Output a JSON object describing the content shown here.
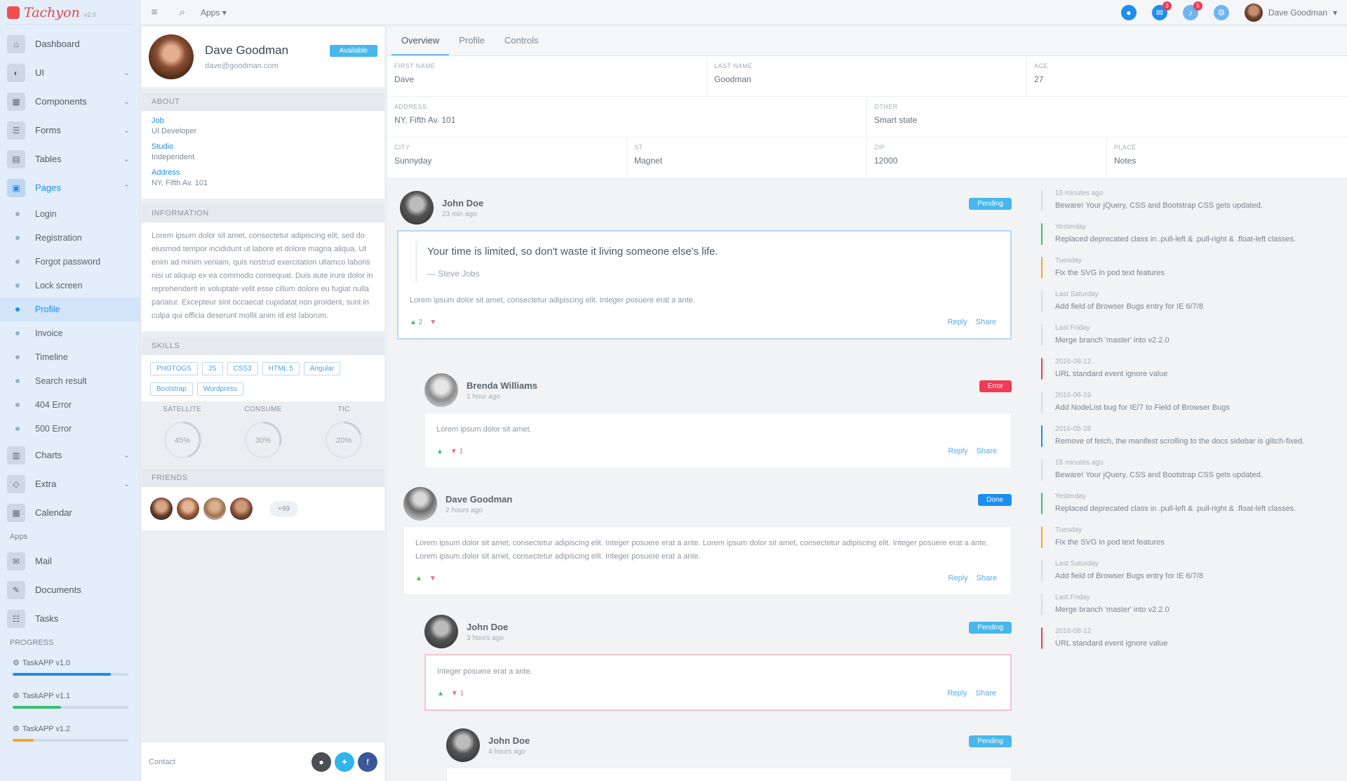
{
  "brand": {
    "name": "Tachyon",
    "sub": "v2.0"
  },
  "sidebar": {
    "items": [
      {
        "label": "Dashboard",
        "icon": "home-icon"
      },
      {
        "label": "UI",
        "icon": "palette-icon",
        "chevron": true
      },
      {
        "label": "Components",
        "icon": "puzzle-icon",
        "chevron": true
      },
      {
        "label": "Forms",
        "icon": "form-icon",
        "chevron": true
      },
      {
        "label": "Tables",
        "icon": "table-icon",
        "chevron": true
      },
      {
        "label": "Pages",
        "icon": "pages-icon",
        "chevron": true,
        "active": true
      }
    ],
    "subitems": [
      {
        "label": "Login"
      },
      {
        "label": "Registration"
      },
      {
        "label": "Forgot password"
      },
      {
        "label": "Lock screen"
      },
      {
        "label": "Profile",
        "active": true
      },
      {
        "label": "Invoice"
      },
      {
        "label": "Timeline"
      },
      {
        "label": "Search result"
      },
      {
        "label": "404 Error"
      },
      {
        "label": "500 Error"
      }
    ],
    "items2": [
      {
        "label": "Charts",
        "icon": "chart-icon",
        "chevron": true
      },
      {
        "label": "Extra",
        "icon": "extra-icon",
        "chevron": true
      },
      {
        "label": "Calendar",
        "icon": "calendar-icon"
      }
    ],
    "apps_head": "Apps",
    "apps": [
      {
        "label": "Mail",
        "icon": "mail-icon"
      },
      {
        "label": "Documents",
        "icon": "pencil-icon"
      },
      {
        "label": "Tasks",
        "icon": "tasks-icon"
      }
    ],
    "progress_head": "PROGRESS",
    "progress": [
      {
        "label": "TaskAPP v1.0",
        "value": 0.85,
        "color": "#1c8ef0"
      },
      {
        "label": "TaskAPP v1.1",
        "value": 0.42,
        "color": "#3cbf6e"
      },
      {
        "label": "TaskAPP v1.2",
        "value": 0.18,
        "color": "#f5a623"
      }
    ]
  },
  "topbar": {
    "language": "Apps",
    "user_name": "Dave Goodman",
    "icons": [
      {
        "name": "circle-icon",
        "color": "#1c8ef0",
        "badge": ""
      },
      {
        "name": "chat-icon",
        "color": "#1c8ef0",
        "badge": "3"
      },
      {
        "name": "bell-icon",
        "color": "#6fb4f2",
        "badge": "5"
      },
      {
        "name": "gear-icon",
        "color": "#6fb4f2",
        "badge": ""
      }
    ]
  },
  "profile": {
    "name": "Dave Goodman",
    "email": "dave@goodman.com",
    "status": "Available",
    "about_head": "ABOUT",
    "about": [
      {
        "key": "Job",
        "value": "UI Developer"
      },
      {
        "key": "Studio",
        "value": "Independent"
      },
      {
        "key": "Address",
        "value": "NY, Fifth Av. 101"
      }
    ],
    "info_head": "INFORMATION",
    "info_text": "Lorem ipsum dolor sit amet, consectetur adipiscing elit, sed do eiusmod tempor incididunt ut labore et dolore magna aliqua. Ut enim ad minim veniam, quis nostrud exercitation ullamco laboris nisi ut aliquip ex ea commodo consequat. Duis aute irure dolor in reprehenderit in voluptate velit esse cillum dolore eu fugiat nulla pariatur. Excepteur sint occaecat cupidatat non proident, sunt in culpa qui officia deserunt mollit anim id est laborum.",
    "skills_head": "SKILLS",
    "skills": [
      "PHOTOGS",
      "JS",
      "CSS3",
      "HTML 5",
      "Angular",
      "Bootstrap",
      "Wordpress"
    ],
    "gauges": [
      {
        "label": "SATELLITE",
        "value": 45,
        "text": "45%"
      },
      {
        "label": "CONSUME",
        "value": 30,
        "text": "30%"
      },
      {
        "label": "TIC",
        "value": 20,
        "text": "20%"
      }
    ],
    "friends_head": "FRIENDS",
    "friends_more": "+99",
    "contact_label": "Contact"
  },
  "main": {
    "tabs": [
      {
        "label": "Overview",
        "active": true
      },
      {
        "label": "Profile"
      },
      {
        "label": "Controls"
      }
    ],
    "fields": [
      [
        {
          "label": "FIRST NAME",
          "value": "Dave"
        },
        {
          "label": "LAST NAME",
          "value": "Goodman"
        },
        {
          "label": "AGE",
          "value": "27"
        }
      ],
      [
        {
          "label": "ADDRESS",
          "value": "NY, Fifth Av. 101"
        },
        {
          "label": "OTHER",
          "value": "Smart state"
        }
      ],
      [
        {
          "label": "CITY",
          "value": "Sunnyday"
        },
        {
          "label": "ST",
          "value": "Magnet"
        },
        {
          "label": "ZIP",
          "value": "12000"
        },
        {
          "label": "PLACE",
          "value": "Notes"
        }
      ]
    ]
  },
  "feed": [
    {
      "name": "John Doe",
      "time": "23 min ago",
      "badge": "Pending",
      "badge_color": "#46b8ee",
      "highlight": "blue",
      "quote": "Your time is limited, so don't waste it living someone else's life.",
      "quote_author": "— Steve Jobs",
      "text": "Lorem ipsum dolor sit amet, consectetur adipiscing elit. Integer posuere erat a ante.",
      "up": "▲ 2",
      "down": "▼",
      "reply": "Reply",
      "share": "Share"
    },
    {
      "name": "Brenda Williams",
      "time": "1 hour ago",
      "badge": "Error",
      "badge_color": "#ef3b55",
      "highlight": "",
      "quote": "",
      "quote_author": "",
      "text": "Lorem ipsum dolor sit amet.",
      "up": "▲",
      "down": "▼ 1",
      "reply": "Reply",
      "share": "Share"
    },
    {
      "name": "Dave Goodman",
      "time": "2 hours ago",
      "badge": "Done",
      "badge_color": "#1c8ef0",
      "highlight": "",
      "quote": "",
      "quote_author": "",
      "text": "Lorem ipsum dolor sit amet, consectetur adipiscing elit. Integer posuere erat a ante. Lorem ipsum dolor sit amet, consectetur adipiscing elit. Integer posuere erat a ante. Lorem ipsum dolor sit amet, consectetur adipiscing elit. Integer posuere erat a ante.",
      "up": "▲",
      "down": "▼",
      "reply": "Reply",
      "share": "Share"
    },
    {
      "name": "John Doe",
      "time": "3 hours ago",
      "badge": "Pending",
      "badge_color": "#46b8ee",
      "highlight": "red",
      "quote": "",
      "quote_author": "",
      "text": "Integer posuere erat a ante.",
      "up": "▲",
      "down": "▼ 1",
      "reply": "Reply",
      "share": "Share"
    },
    {
      "name": "John Doe",
      "time": "4 hours ago",
      "badge": "Pending",
      "badge_color": "#46b8ee",
      "highlight": "",
      "quote": "",
      "quote_author": "",
      "text": "",
      "up": "",
      "down": "",
      "reply": "",
      "share": ""
    }
  ],
  "timeline": [
    {
      "time": "15 minutes ago",
      "text": "Beware! Your jQuery, CSS and Bootstrap CSS gets updated.",
      "color": "#d7dde3"
    },
    {
      "time": "Yesterday",
      "text": "Replaced deprecated class in .pull-left & .pull-right & .float-left classes.",
      "color": "#3cbf6e"
    },
    {
      "time": "Tuesday",
      "text": "Fix the SVG in pod text features",
      "color": "#f5a623"
    },
    {
      "time": "Last Saturday",
      "text": "Add field of Browser Bugs entry for IE 6/7/8",
      "color": "#d7dde3"
    },
    {
      "time": "Last Friday",
      "text": "Merge branch 'master' into v2.2.0",
      "color": "#d7dde3"
    },
    {
      "time": "2016-08-12",
      "text": "URL standard event ignore value",
      "color": "#ef3b55"
    },
    {
      "time": "2016-06-19",
      "text": "Add NodeList bug for IE/7 to Field of Browser Bugs",
      "color": "#d7dde3"
    },
    {
      "time": "2016-05-28",
      "text": "Remove of fetch, the manifest scrolling to the docs sidebar is glitch-fixed.",
      "color": "#1c8ef0"
    },
    {
      "time": "15 minutes ago",
      "text": "Beware! Your jQuery, CSS and Bootstrap CSS gets updated.",
      "color": "#d7dde3"
    },
    {
      "time": "Yesterday",
      "text": "Replaced deprecated class in .pull-left & .pull-right & .float-left classes.",
      "color": "#3cbf6e"
    },
    {
      "time": "Tuesday",
      "text": "Fix the SVG in pod text features",
      "color": "#f5a623"
    },
    {
      "time": "Last Saturday",
      "text": "Add field of Browser Bugs entry for IE 6/7/8",
      "color": "#d7dde3"
    },
    {
      "time": "Last Friday",
      "text": "Merge branch 'master' into v2.2.0",
      "color": "#d7dde3"
    },
    {
      "time": "2016-08-12",
      "text": "URL standard event ignore value",
      "color": "#ef3b55"
    }
  ]
}
